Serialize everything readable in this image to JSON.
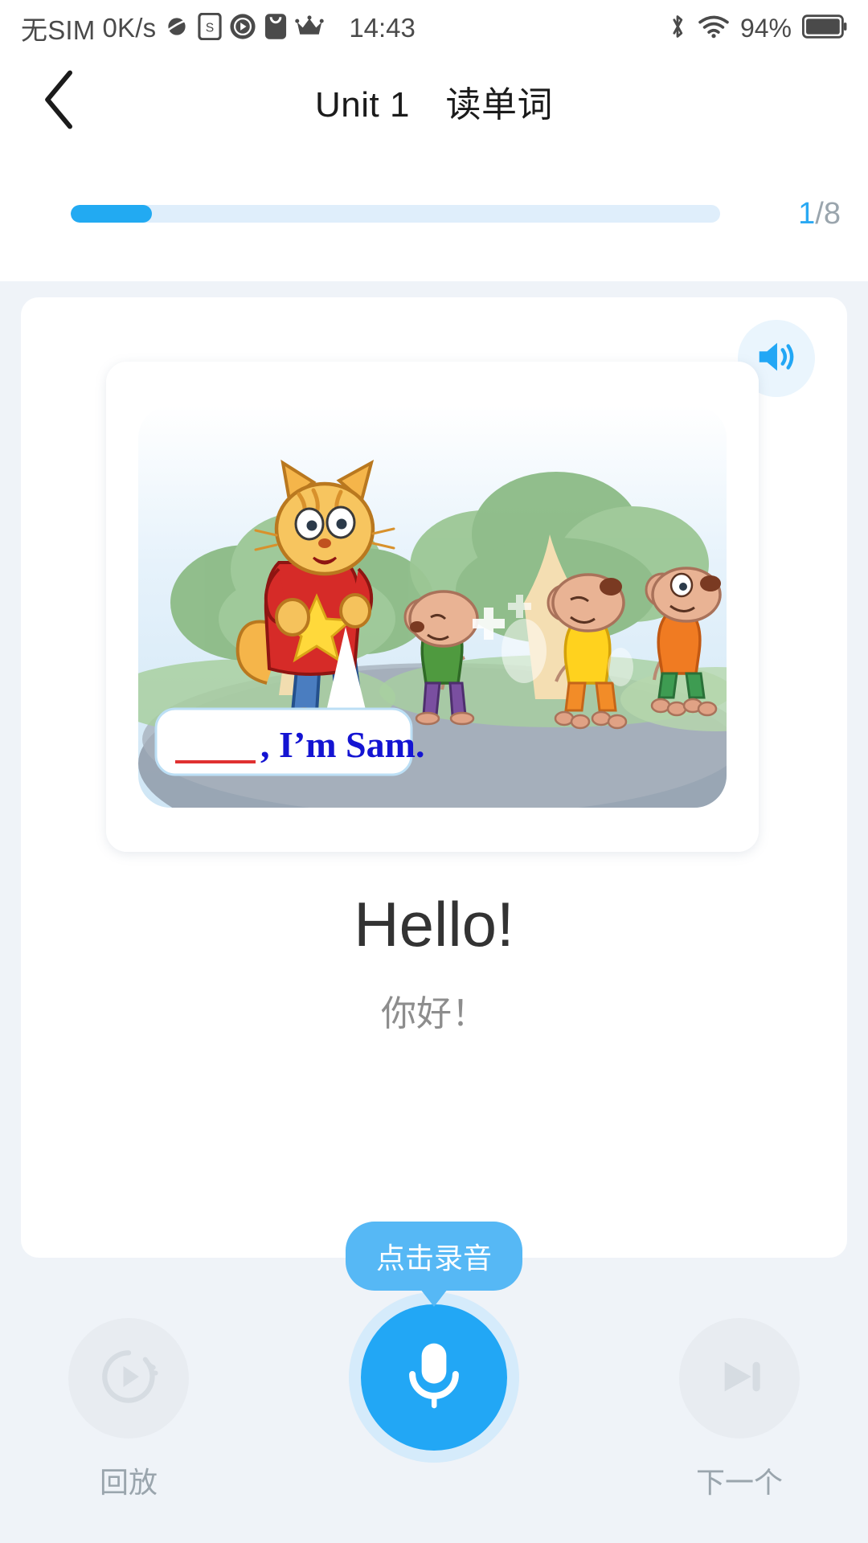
{
  "status_bar": {
    "carrier": "无SIM",
    "network_speed": "0K/s",
    "clock": "14:43",
    "battery_percent": "94%",
    "icons": [
      "saturn-icon",
      "s-badge-icon",
      "play-circle-icon",
      "shopping-bag-icon",
      "crown-icon",
      "bluetooth-icon",
      "wifi-icon",
      "battery-icon"
    ]
  },
  "header": {
    "back_icon": "chevron-left-icon",
    "title": "Unit 1　读单词"
  },
  "progress": {
    "current": "1",
    "separator_total": "/8",
    "percent": 12.5,
    "fill_color": "#22aaf2",
    "track_color": "#dfeefb"
  },
  "card": {
    "speaker_icon": "speaker-wave-icon",
    "illustration": {
      "alt": "卡通场景：橙色猫和三只老鼠在公园里",
      "speech_bubble": {
        "blank": "______",
        "text": ", I'm Sam.",
        "text_color": "#1414d2",
        "blank_color": "#e03131"
      }
    },
    "word": "Hello!",
    "translation": "你好！"
  },
  "tooltip": {
    "label": "点击录音",
    "bg_color": "#56b8f5"
  },
  "controls": {
    "playback": {
      "label": "回放",
      "icon": "play-progress-circle-icon",
      "enabled": false
    },
    "record": {
      "label": "",
      "icon": "microphone-icon",
      "color": "#22a7f5",
      "ring_color": "#d5ebfb"
    },
    "next": {
      "label": "下一个",
      "icon": "skip-next-icon",
      "enabled": false
    }
  },
  "theme": {
    "page_bg": "#eff3f8",
    "card_bg": "#ffffff",
    "accent": "#22a7f5",
    "muted_text": "#9aa5ad"
  }
}
